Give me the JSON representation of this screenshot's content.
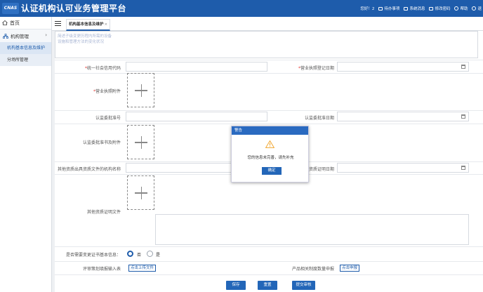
{
  "header": {
    "logo_text": "CNAS",
    "app_title": "认证机构认可业务管理平台",
    "user_greeting": "您好！2",
    "menu": [
      "待办事项",
      "系统消息",
      "修改密码",
      "帮助"
    ],
    "close_fragment": "退"
  },
  "sidebar": {
    "home": "首页",
    "group": "机构管理",
    "items": [
      "机构基本信息及维护",
      "分场所管理"
    ]
  },
  "tabs": [
    {
      "label": "机构基本信息及维护",
      "close": "×"
    }
  ],
  "form": {
    "hint_text": [
      "简述子级变更历程内所需的设备",
      "设施和管理方法的变化状况"
    ],
    "credit_code_label": "统一社会信用代码",
    "license_reg_date_label": "营业执照登记日期",
    "license_attachment_label": "营业执照附件",
    "approval_no_label": "认监委批准号",
    "approval_date_label": "认监委批准日期",
    "approval_attachment_label": "认监委批准书及附件",
    "other_org_label": "其他资质出具资质文件的机构名称",
    "other_date_label": "资质证明日期",
    "other_proof_label": "其他资质证明文件",
    "change_cert_label": "是否需要变更证书基本信息：",
    "radio_no": "否",
    "radio_yes": "是",
    "eval_plan_label": "评审策划填报输入表",
    "eval_plan_btn": "点击上传文件",
    "product_count_label": "产品相关制度数量申报",
    "product_count_btn": "点击申报"
  },
  "actions": {
    "save": "保存",
    "reset": "重置",
    "submit": "提交审核"
  },
  "dialog": {
    "title": "警告",
    "message": "您的信息未完善，请先补充",
    "ok": "确定"
  },
  "colors": {
    "brand": "#1e5cab",
    "required": "#e53935",
    "warning": "#f0a020"
  }
}
